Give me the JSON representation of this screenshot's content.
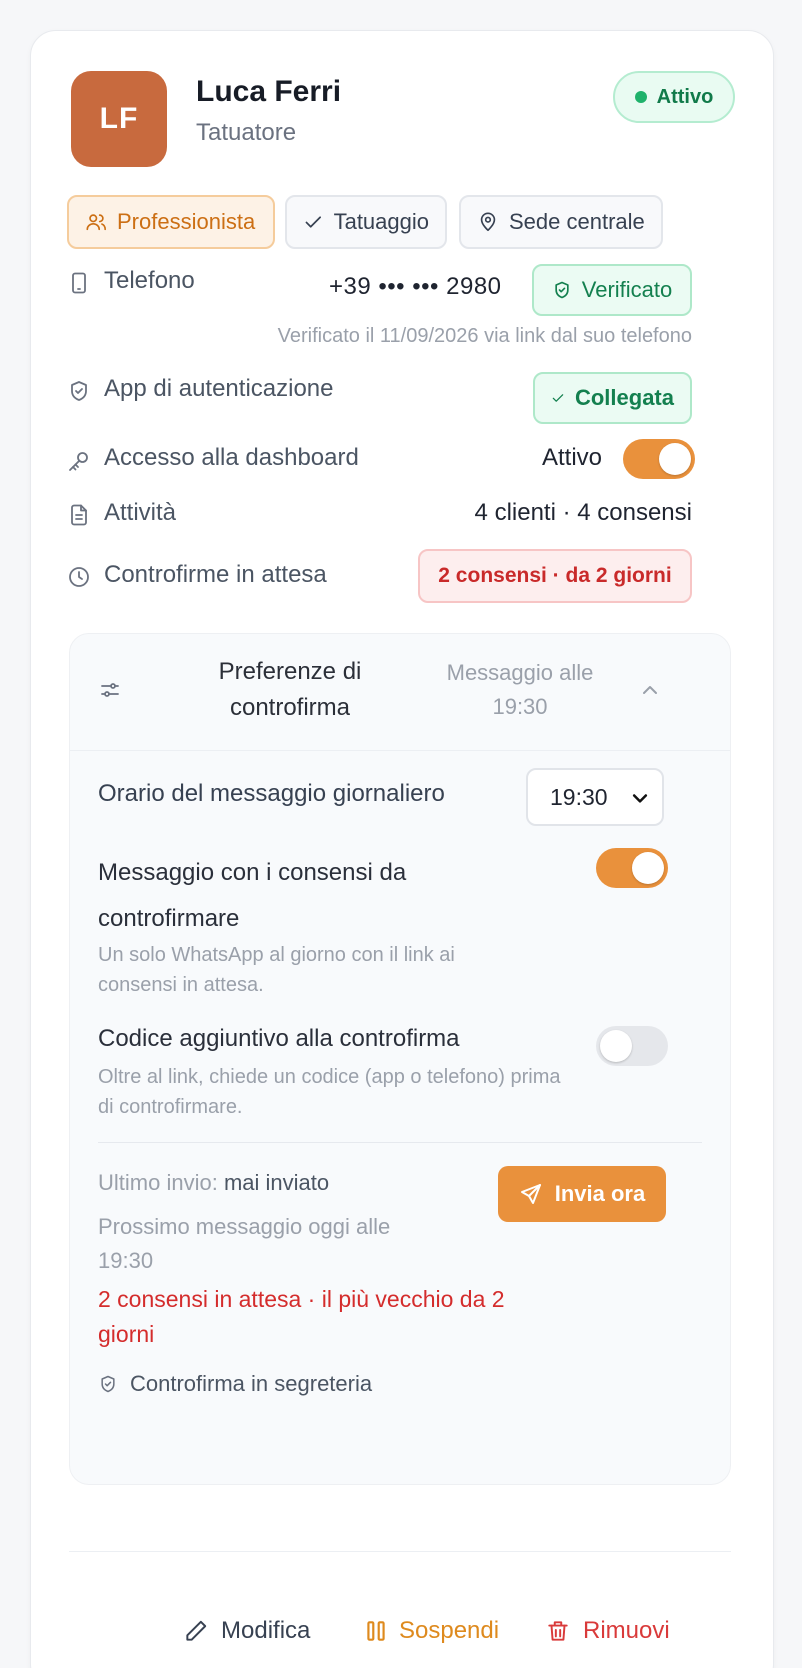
{
  "profile": {
    "initials": "LF",
    "name": "Luca Ferri",
    "role": "Tatuatore",
    "status": "Attivo",
    "colors": {
      "avatar": "#c86a3e",
      "accent": "#e9913c"
    }
  },
  "tags": [
    {
      "label": "Professionista",
      "icon": "users-icon"
    },
    {
      "label": "Tatuaggio",
      "icon": "check-icon"
    },
    {
      "label": "Sede centrale",
      "icon": "map-pin-icon"
    }
  ],
  "details": {
    "phone_label": "Telefono",
    "phone_value": "+39 ••• ••• 2980",
    "phone_badge": "Verificato",
    "phone_note": "Verificato il 11/09/2026 via link dal suo telefono",
    "auth_label": "App di autenticazione",
    "auth_badge": "Collegata",
    "dashboard_label": "Accesso alla dashboard",
    "dashboard_value": "Attivo",
    "dashboard_enabled": true,
    "activity_label": "Attività",
    "activity_value": "4 clienti · 4 consensi",
    "pending_label": "Controfirme in attesa",
    "pending_badge": "2 consensi · da 2 giorni"
  },
  "panel": {
    "title": "Preferenze di controfirma",
    "subtitle": "Messaggio alle 19:30",
    "time_label": "Orario del messaggio giornaliero",
    "time_value": "19:30",
    "pref1_title": "Messaggio con i consensi da controfirmare",
    "pref1_desc": "Un solo WhatsApp al giorno con il link ai consensi in attesa.",
    "pref1_enabled": true,
    "pref2_title": "Codice aggiuntivo alla controfirma",
    "pref2_desc": "Oltre al link, chiede un codice (app o telefono) prima di controfirmare.",
    "pref2_enabled": false,
    "last_send_label": "Ultimo invio:",
    "last_send_value": "mai inviato",
    "next_message": "Prossimo messaggio oggi alle 19:30",
    "pending_warning": "2 consensi in attesa · il più vecchio da 2 giorni",
    "fallback": "Controfirma in segreteria",
    "send_button": "Invia ora"
  },
  "actions": {
    "edit": "Modifica",
    "suspend": "Sospendi",
    "remove": "Rimuovi"
  }
}
